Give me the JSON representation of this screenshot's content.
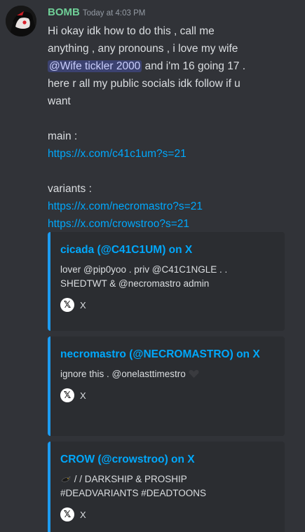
{
  "message": {
    "username": "BOMB",
    "timestamp": "Today at 4:03 PM",
    "lines": [
      "Hi okay idk how to do this , call me",
      "anything , any pronouns , i love my wife",
      "and i'm 16 going 17 .",
      "here r all my public socials idk follow if u",
      "want",
      "main :",
      "variants :"
    ],
    "mention": "@Wife tickler 2000",
    "links": {
      "main": "https://x.com/c41c1um?s=21",
      "variant_1": "https://x.com/necromastro?s=21",
      "variant_2": "https://x.com/crowstroo?s=21"
    }
  },
  "embeds": [
    {
      "title": "cicada (@C41C1UM) on X",
      "description": [
        "lover @pip0yoo . priv @C41C1NGLE . .",
        "SHEDTWT & @necromastro admin"
      ],
      "footer": "X",
      "accent_color": "#1d9bf0"
    },
    {
      "title": "necromastro (@NECROMASTRO) on X",
      "description": [
        "ignore this . @onelasttimestro"
      ],
      "footer": "X",
      "accent_color": "#1d9bf0"
    },
    {
      "title": "CROW (@crowstroo) on X",
      "description": [
        "/ / DARKSHIP & PROSHIP",
        "#DEADVARIANTS #DEADTOONS"
      ],
      "footer": "X",
      "accent_color": "#1d9bf0"
    }
  ],
  "icons": {
    "avatar": "avatar-image",
    "x_logo": "x-logo-icon",
    "heart": "black-heart-icon",
    "emoji": "crow-emoji-icon"
  },
  "colors": {
    "background": "#313338",
    "username": "#6fcf97",
    "link": "#00a8fc",
    "mention_bg": "#3c4270",
    "embed_bg": "#2b2d31"
  }
}
